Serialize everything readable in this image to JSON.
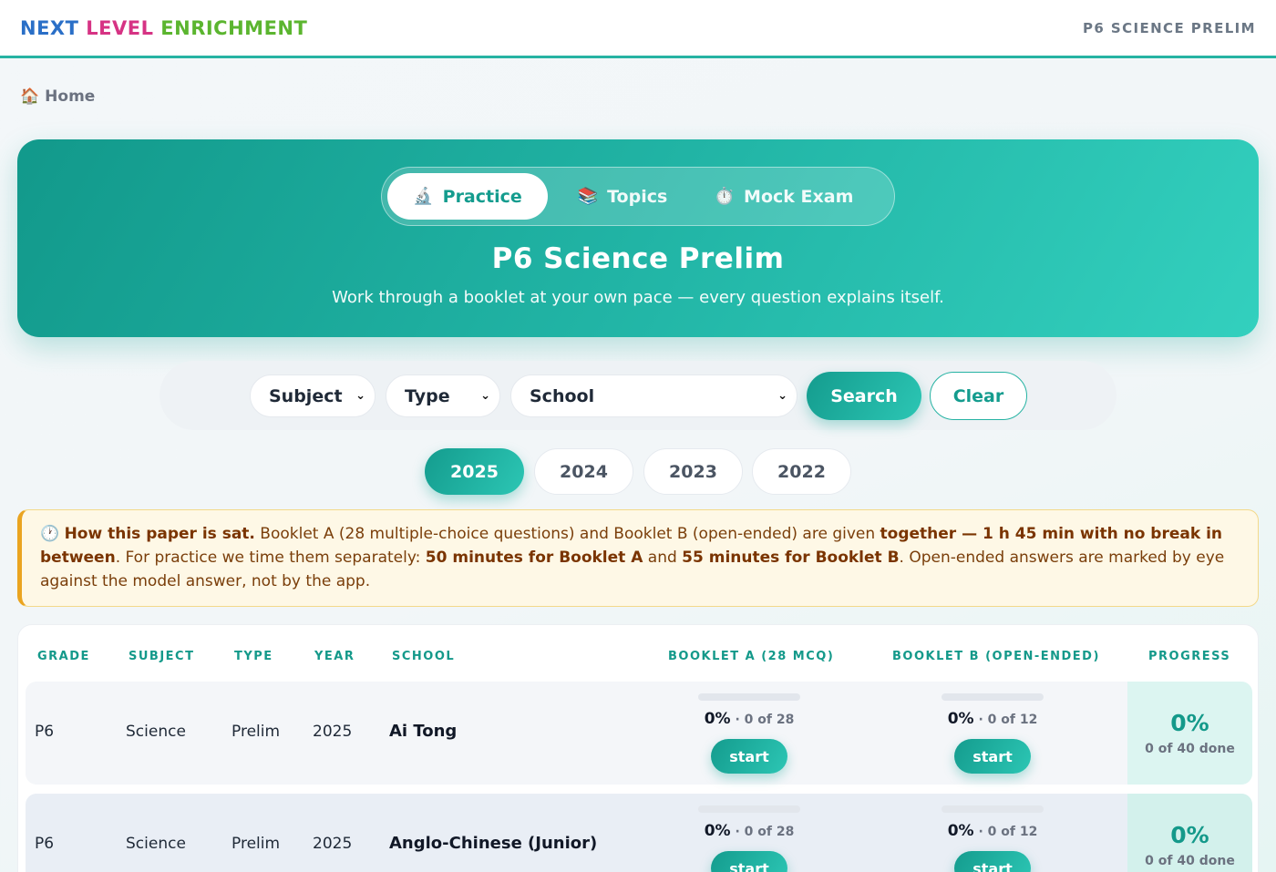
{
  "brand": {
    "word1": "NEXT",
    "word2": "LEVEL",
    "word3": "ENRICHMENT",
    "colors": [
      "#2a6fc7",
      "#d63384",
      "#5bb52f"
    ]
  },
  "header": {
    "right_title": "P6 SCIENCE PRELIM"
  },
  "breadcrumb": {
    "icon": "home-icon",
    "icon_glyph": "🏠",
    "label": "Home"
  },
  "hero": {
    "tabs": [
      {
        "label": "Practice",
        "icon": "microscope-icon",
        "glyph": "🔬",
        "active": true
      },
      {
        "label": "Topics",
        "icon": "books-icon",
        "glyph": "📚",
        "active": false
      },
      {
        "label": "Mock Exam",
        "icon": "stopwatch-icon",
        "glyph": "⏱️",
        "active": false
      }
    ],
    "title": "P6 Science Prelim",
    "subtitle": "Work through a booklet at your own pace — every question explains itself."
  },
  "filters": {
    "subject": "Subject",
    "type": "Type",
    "school": "School",
    "search_label": "Search",
    "clear_label": "Clear"
  },
  "years": [
    {
      "label": "2025",
      "active": true
    },
    {
      "label": "2024",
      "active": false
    },
    {
      "label": "2023",
      "active": false
    },
    {
      "label": "2022",
      "active": false
    }
  ],
  "notice": {
    "icon": "clock-icon",
    "glyph": "🕐",
    "lead": "How this paper is sat.",
    "t1": " Booklet A (28 multiple-choice questions) and Booklet B (open-ended) are given ",
    "b1": "together — 1 h 45 min with no break in between",
    "t2": ". For practice we time them separately: ",
    "b2": "50 minutes for Booklet A",
    "t3": " and ",
    "b3": "55 minutes for Booklet B",
    "t4": ". Open-ended answers are marked by eye against the model answer, not by the app."
  },
  "table": {
    "headers": [
      "GRADE",
      "SUBJECT",
      "TYPE",
      "YEAR",
      "SCHOOL",
      "BOOKLET A (28 MCQ)",
      "BOOKLET B (OPEN-ENDED)",
      "PROGRESS"
    ],
    "rows": [
      {
        "grade": "P6",
        "subject": "Science",
        "type": "Prelim",
        "year": "2025",
        "school": "Ai Tong",
        "booklet_a": {
          "pct": "0%",
          "count": "· 0 of 28",
          "progress": 0,
          "action": "start"
        },
        "booklet_b": {
          "pct": "0%",
          "count": "· 0 of 12",
          "progress": 0,
          "action": "start"
        },
        "progress": {
          "pct": "0%",
          "done": "0 of 40 done"
        }
      },
      {
        "grade": "P6",
        "subject": "Science",
        "type": "Prelim",
        "year": "2025",
        "school": "Anglo-Chinese (Junior)",
        "booklet_a": {
          "pct": "0%",
          "count": "· 0 of 28",
          "progress": 0,
          "action": "start"
        },
        "booklet_b": {
          "pct": "0%",
          "count": "· 0 of 12",
          "progress": 0,
          "action": "start"
        },
        "progress": {
          "pct": "0%",
          "done": "0 of 40 done"
        }
      }
    ]
  }
}
